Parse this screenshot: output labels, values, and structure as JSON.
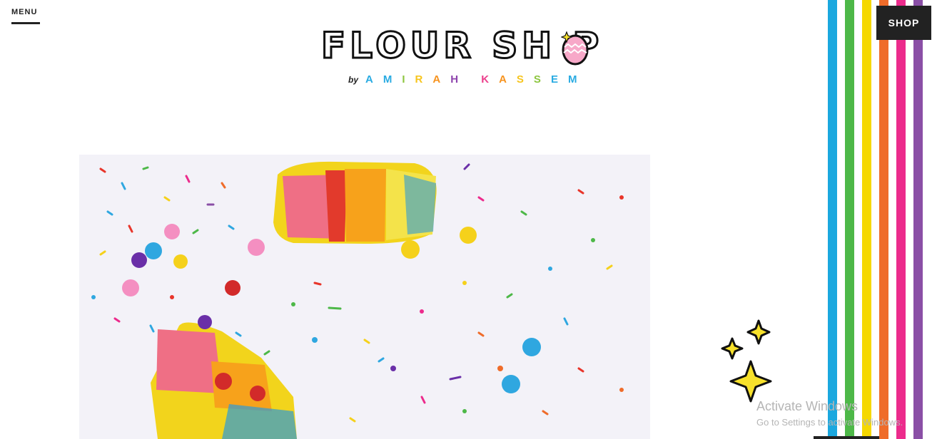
{
  "header": {
    "menu_label": "MENU",
    "shop_label": "SHOP",
    "logo_title": "FLOUR SH P",
    "logo_by": "by",
    "logo_name_letters": [
      {
        "ch": "A",
        "color": "#29abe2"
      },
      {
        "ch": "M",
        "color": "#29abe2"
      },
      {
        "ch": "I",
        "color": "#8dc63f"
      },
      {
        "ch": "R",
        "color": "#f7c51e"
      },
      {
        "ch": "A",
        "color": "#f7931e"
      },
      {
        "ch": "H",
        "color": "#8e44ad"
      },
      {
        "ch": " ",
        "color": "#ffffff"
      },
      {
        "ch": "K",
        "color": "#ec3f8c"
      },
      {
        "ch": "A",
        "color": "#f7931e"
      },
      {
        "ch": "S",
        "color": "#f7c51e"
      },
      {
        "ch": "S",
        "color": "#8dc63f"
      },
      {
        "ch": "E",
        "color": "#29abe2"
      },
      {
        "ch": "M",
        "color": "#29abe2"
      }
    ]
  },
  "hero": {
    "image_icon": "rainbow-cake-sprinkles-photo"
  },
  "decor": {
    "stripe_colors": [
      "#1ba8df",
      "#4db848",
      "#f5d800",
      "#ef6c2a",
      "#ec2b8c",
      "#8a4fa6"
    ],
    "sparkle_color": "#f7e12b"
  },
  "watermark": {
    "title": "Activate Windows",
    "subtitle": "Go to Settings to activate Windows."
  }
}
